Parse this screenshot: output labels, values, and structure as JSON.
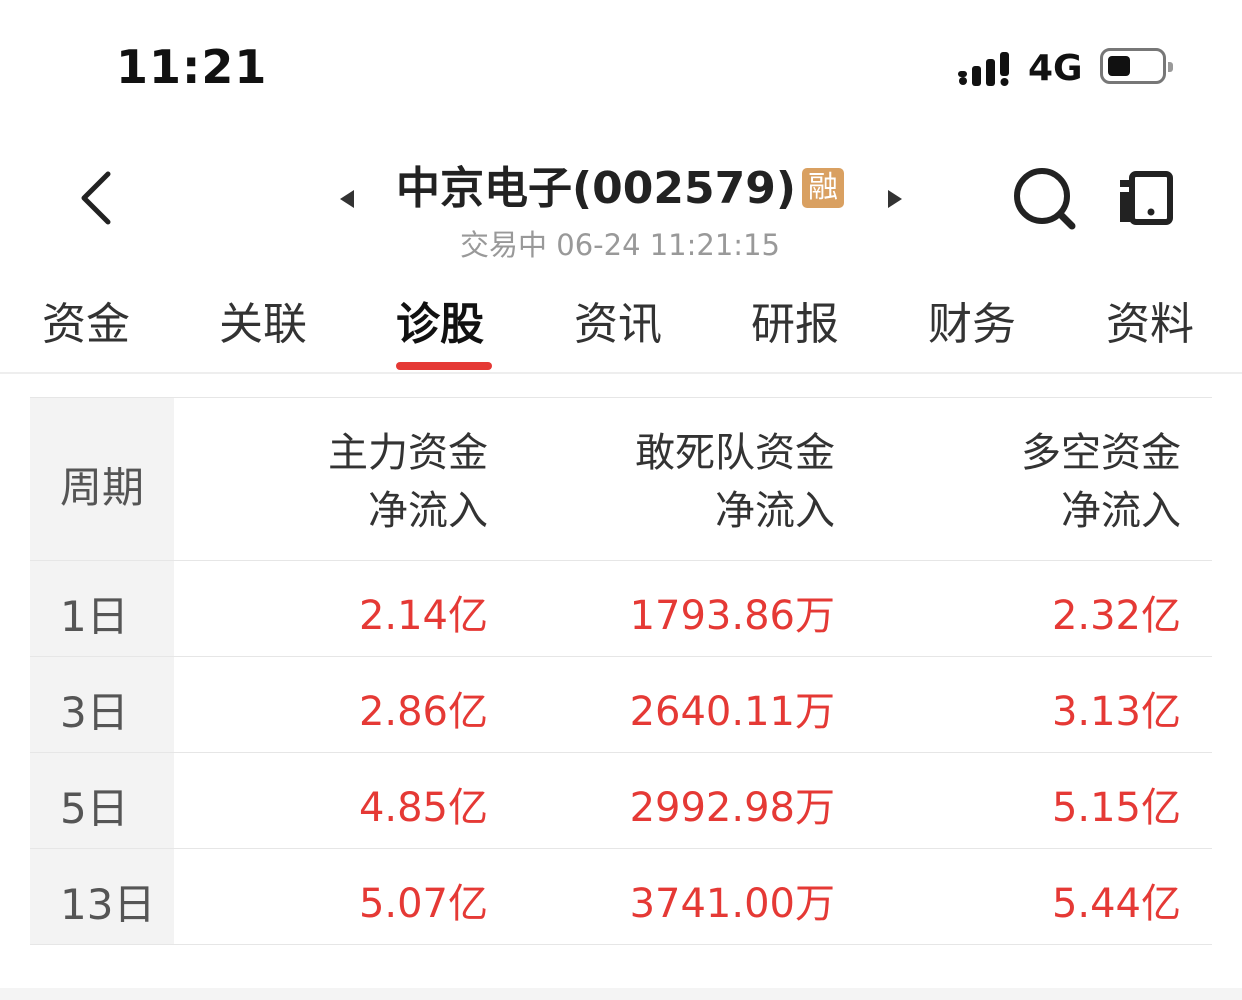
{
  "status_bar": {
    "time": "11:21",
    "network": "4G"
  },
  "header": {
    "stock_name": "中京电子(002579)",
    "badge": "融",
    "status": "交易中",
    "timestamp": "06-24 11:21:15"
  },
  "tabs": [
    "资金",
    "关联",
    "诊股",
    "资讯",
    "研报",
    "财务",
    "资料"
  ],
  "active_tab": "诊股",
  "table": {
    "period_header": "周期",
    "columns": [
      {
        "line1": "主力资金",
        "line2": "净流入"
      },
      {
        "line1": "敢死队资金",
        "line2": "净流入"
      },
      {
        "line1": "多空资金",
        "line2": "净流入"
      }
    ],
    "rows": [
      {
        "period": "1日",
        "main": "2.14亿",
        "dare": "1793.86万",
        "longshort": "2.32亿"
      },
      {
        "period": "3日",
        "main": "2.86亿",
        "dare": "2640.11万",
        "longshort": "3.13亿"
      },
      {
        "period": "5日",
        "main": "4.85亿",
        "dare": "2992.98万",
        "longshort": "5.15亿"
      },
      {
        "period": "13日",
        "main": "5.07亿",
        "dare": "3741.00万",
        "longshort": "5.44亿"
      }
    ]
  },
  "colors": {
    "accent": "#e53935",
    "badge": "#d9a061",
    "period_bg": "#f3f3f3"
  }
}
